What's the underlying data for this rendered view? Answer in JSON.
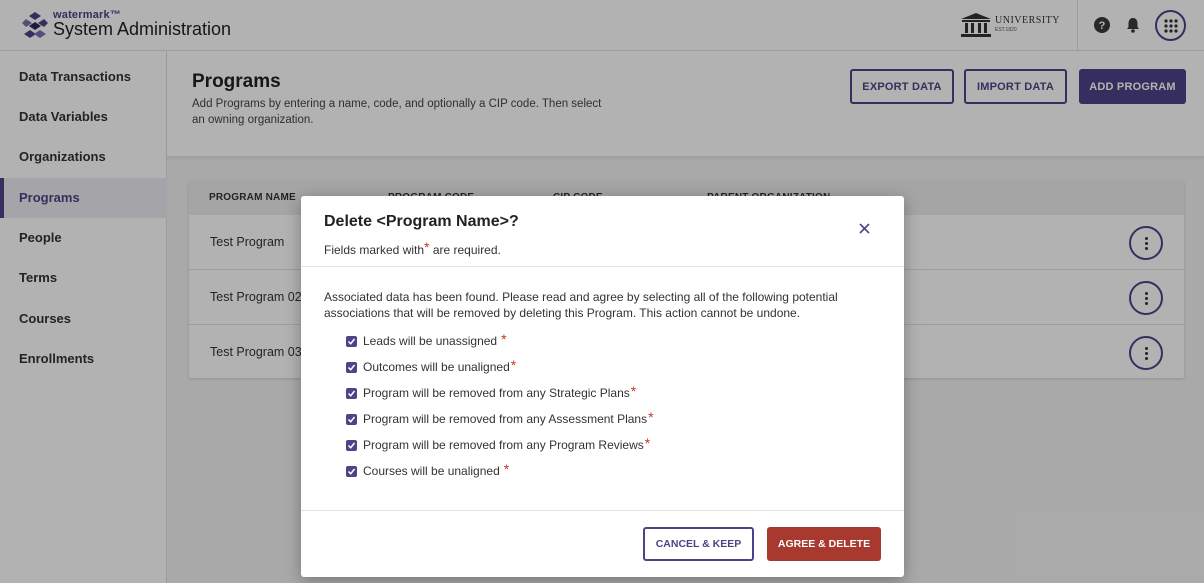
{
  "header": {
    "brand_small": "watermark™",
    "brand_title": "System Administration",
    "university_name": "UNIVERSITY",
    "university_est": "EST.1820",
    "help_icon": "help-circle-icon",
    "bell_icon": "bell-icon",
    "apps_icon": "apps-grid-icon"
  },
  "sidebar": {
    "items": [
      {
        "label": "Data Transactions"
      },
      {
        "label": "Data Variables"
      },
      {
        "label": "Organizations"
      },
      {
        "label": "Programs",
        "active": true
      },
      {
        "label": "People"
      },
      {
        "label": "Terms"
      },
      {
        "label": "Courses"
      },
      {
        "label": "Enrollments"
      }
    ]
  },
  "page": {
    "title": "Programs",
    "description": "Add Programs by entering a name, code, and optionally a CIP code. Then select an owning organization.",
    "export_label": "EXPORT DATA",
    "import_label": "IMPORT DATA",
    "add_label": "ADD PROGRAM"
  },
  "table": {
    "columns": [
      "PROGRAM NAME",
      "PROGRAM CODE",
      "CIP CODE",
      "PARENT ORGANIZATION"
    ],
    "rows": [
      {
        "name": "Test Program"
      },
      {
        "name": "Test Program 02"
      },
      {
        "name": "Test Program 03"
      }
    ]
  },
  "modal": {
    "title": "Delete <Program Name>?",
    "required_prefix": "Fields marked with",
    "required_star": "*",
    "required_suffix": "are required.",
    "close_icon": "close-icon",
    "message": "Associated data has been found. Please read and agree by selecting all of the following potential associations that will be removed by deleting this Program. This action cannot be undone.",
    "checkboxes": [
      {
        "label": "Leads will be unassigned",
        "checked": true
      },
      {
        "label": "Outcomes will be unaligned",
        "checked": true
      },
      {
        "label": "Program will be removed from any Strategic Plans",
        "checked": true
      },
      {
        "label": "Program will be removed from any Assessment Plans",
        "checked": true
      },
      {
        "label": "Program will be removed from any Program Reviews",
        "checked": true
      },
      {
        "label": "Courses will be unaligned",
        "checked": true
      }
    ],
    "cancel_label": "CANCEL & KEEP",
    "delete_label": "AGREE & DELETE"
  },
  "colors": {
    "primary": "#4e4387",
    "danger": "#a8392f",
    "required": "#c0392b"
  }
}
